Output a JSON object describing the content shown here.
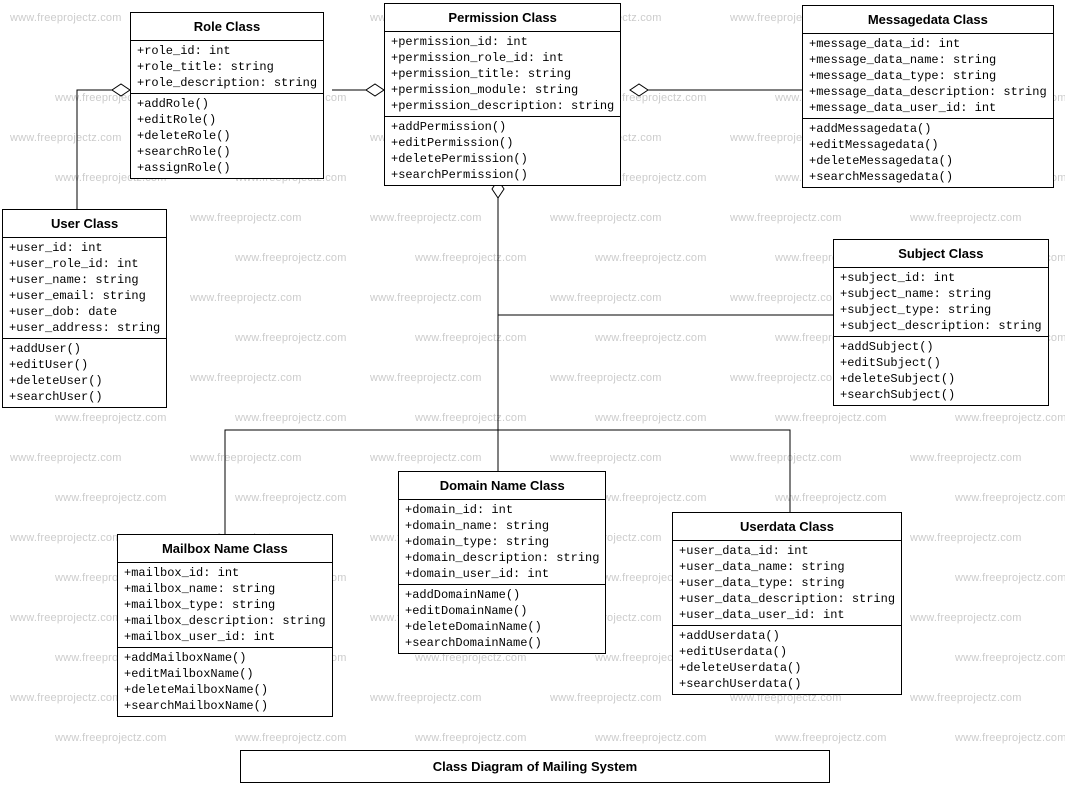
{
  "watermark_text": "www.freeprojectz.com",
  "caption": "Class Diagram of Mailing System",
  "classes": {
    "role": {
      "title": "Role Class",
      "attrs": [
        "+role_id: int",
        "+role_title: string",
        "+role_description: string"
      ],
      "methods": [
        "+addRole()",
        "+editRole()",
        "+deleteRole()",
        "+searchRole()",
        "+assignRole()"
      ]
    },
    "permission": {
      "title": "Permission Class",
      "attrs": [
        "+permission_id: int",
        "+permission_role_id: int",
        "+permission_title: string",
        "+permission_module: string",
        "+permission_description: string"
      ],
      "methods": [
        "+addPermission()",
        "+editPermission()",
        "+deletePermission()",
        "+searchPermission()"
      ]
    },
    "messagedata": {
      "title": "Messagedata Class",
      "attrs": [
        "+message_data_id: int",
        "+message_data_name: string",
        "+message_data_type: string",
        "+message_data_description: string",
        "+message_data_user_id: int"
      ],
      "methods": [
        "+addMessagedata()",
        "+editMessagedata()",
        "+deleteMessagedata()",
        "+searchMessagedata()"
      ]
    },
    "user": {
      "title": "User Class",
      "attrs": [
        "+user_id: int",
        "+user_role_id: int",
        "+user_name: string",
        "+user_email: string",
        "+user_dob: date",
        "+user_address: string"
      ],
      "methods": [
        "+addUser()",
        "+editUser()",
        "+deleteUser()",
        "+searchUser()"
      ]
    },
    "subject": {
      "title": "Subject Class",
      "attrs": [
        "+subject_id: int",
        "+subject_name: string",
        "+subject_type: string",
        "+subject_description: string"
      ],
      "methods": [
        "+addSubject()",
        "+editSubject()",
        "+deleteSubject()",
        "+searchSubject()"
      ]
    },
    "domain": {
      "title": "Domain Name Class",
      "attrs": [
        "+domain_id: int",
        "+domain_name: string",
        "+domain_type: string",
        "+domain_description: string",
        "+domain_user_id: int"
      ],
      "methods": [
        "+addDomainName()",
        "+editDomainName()",
        "+deleteDomainName()",
        "+searchDomainName()"
      ]
    },
    "userdata": {
      "title": "Userdata Class",
      "attrs": [
        "+user_data_id: int",
        "+user_data_name: string",
        "+user_data_type: string",
        "+user_data_description: string",
        "+user_data_user_id: int"
      ],
      "methods": [
        "+addUserdata()",
        "+editUserdata()",
        "+deleteUserdata()",
        "+searchUserdata()"
      ]
    },
    "mailbox": {
      "title": "Mailbox Name Class",
      "attrs": [
        "+mailbox_id: int",
        "+mailbox_name: string",
        "+mailbox_type: string",
        "+mailbox_description: string",
        "+mailbox_user_id: int"
      ],
      "methods": [
        "+addMailboxName()",
        "+editMailboxName()",
        "+deleteMailboxName()",
        "+searchMailboxName()"
      ]
    }
  }
}
